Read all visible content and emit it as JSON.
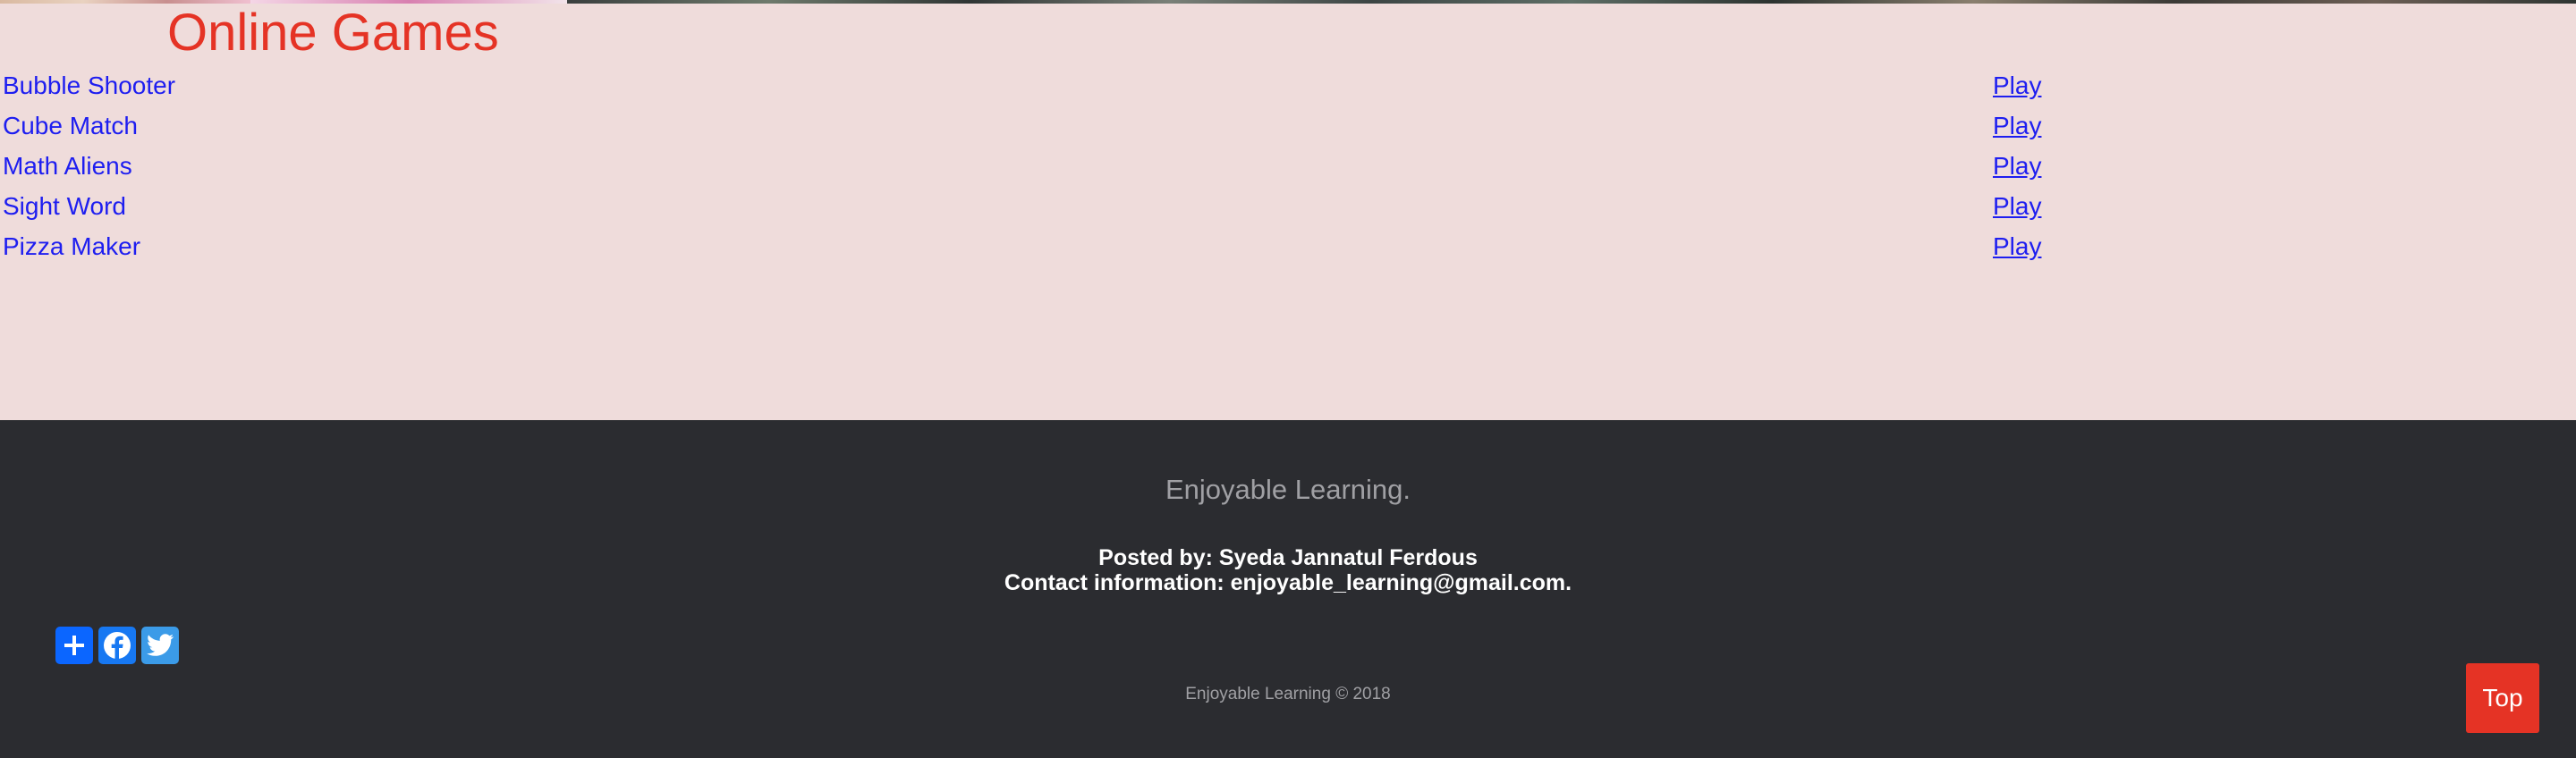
{
  "header": {
    "title": "Online Games"
  },
  "games": [
    {
      "name": "Bubble Shooter",
      "action": "Play"
    },
    {
      "name": "Cube Match",
      "action": "Play"
    },
    {
      "name": "Math Aliens",
      "action": "Play"
    },
    {
      "name": "Sight Word",
      "action": "Play"
    },
    {
      "name": "Pizza Maker",
      "action": "Play"
    }
  ],
  "footer": {
    "tagline": "Enjoyable Learning.",
    "posted_by": "Posted by: Syeda Jannatul Ferdous",
    "contact": "Contact information: enjoyable_learning@gmail.com.",
    "share_icons": [
      "share-plus-icon",
      "facebook-icon",
      "twitter-icon"
    ],
    "copyright": "Enjoyable Learning © 2018"
  },
  "top_button": {
    "label": "Top"
  },
  "colors": {
    "title": "#e53325",
    "link": "#1e1ef0",
    "content_bg": "#efdcdb",
    "footer_bg": "#2b2c30",
    "top_button_bg": "#e53325"
  }
}
